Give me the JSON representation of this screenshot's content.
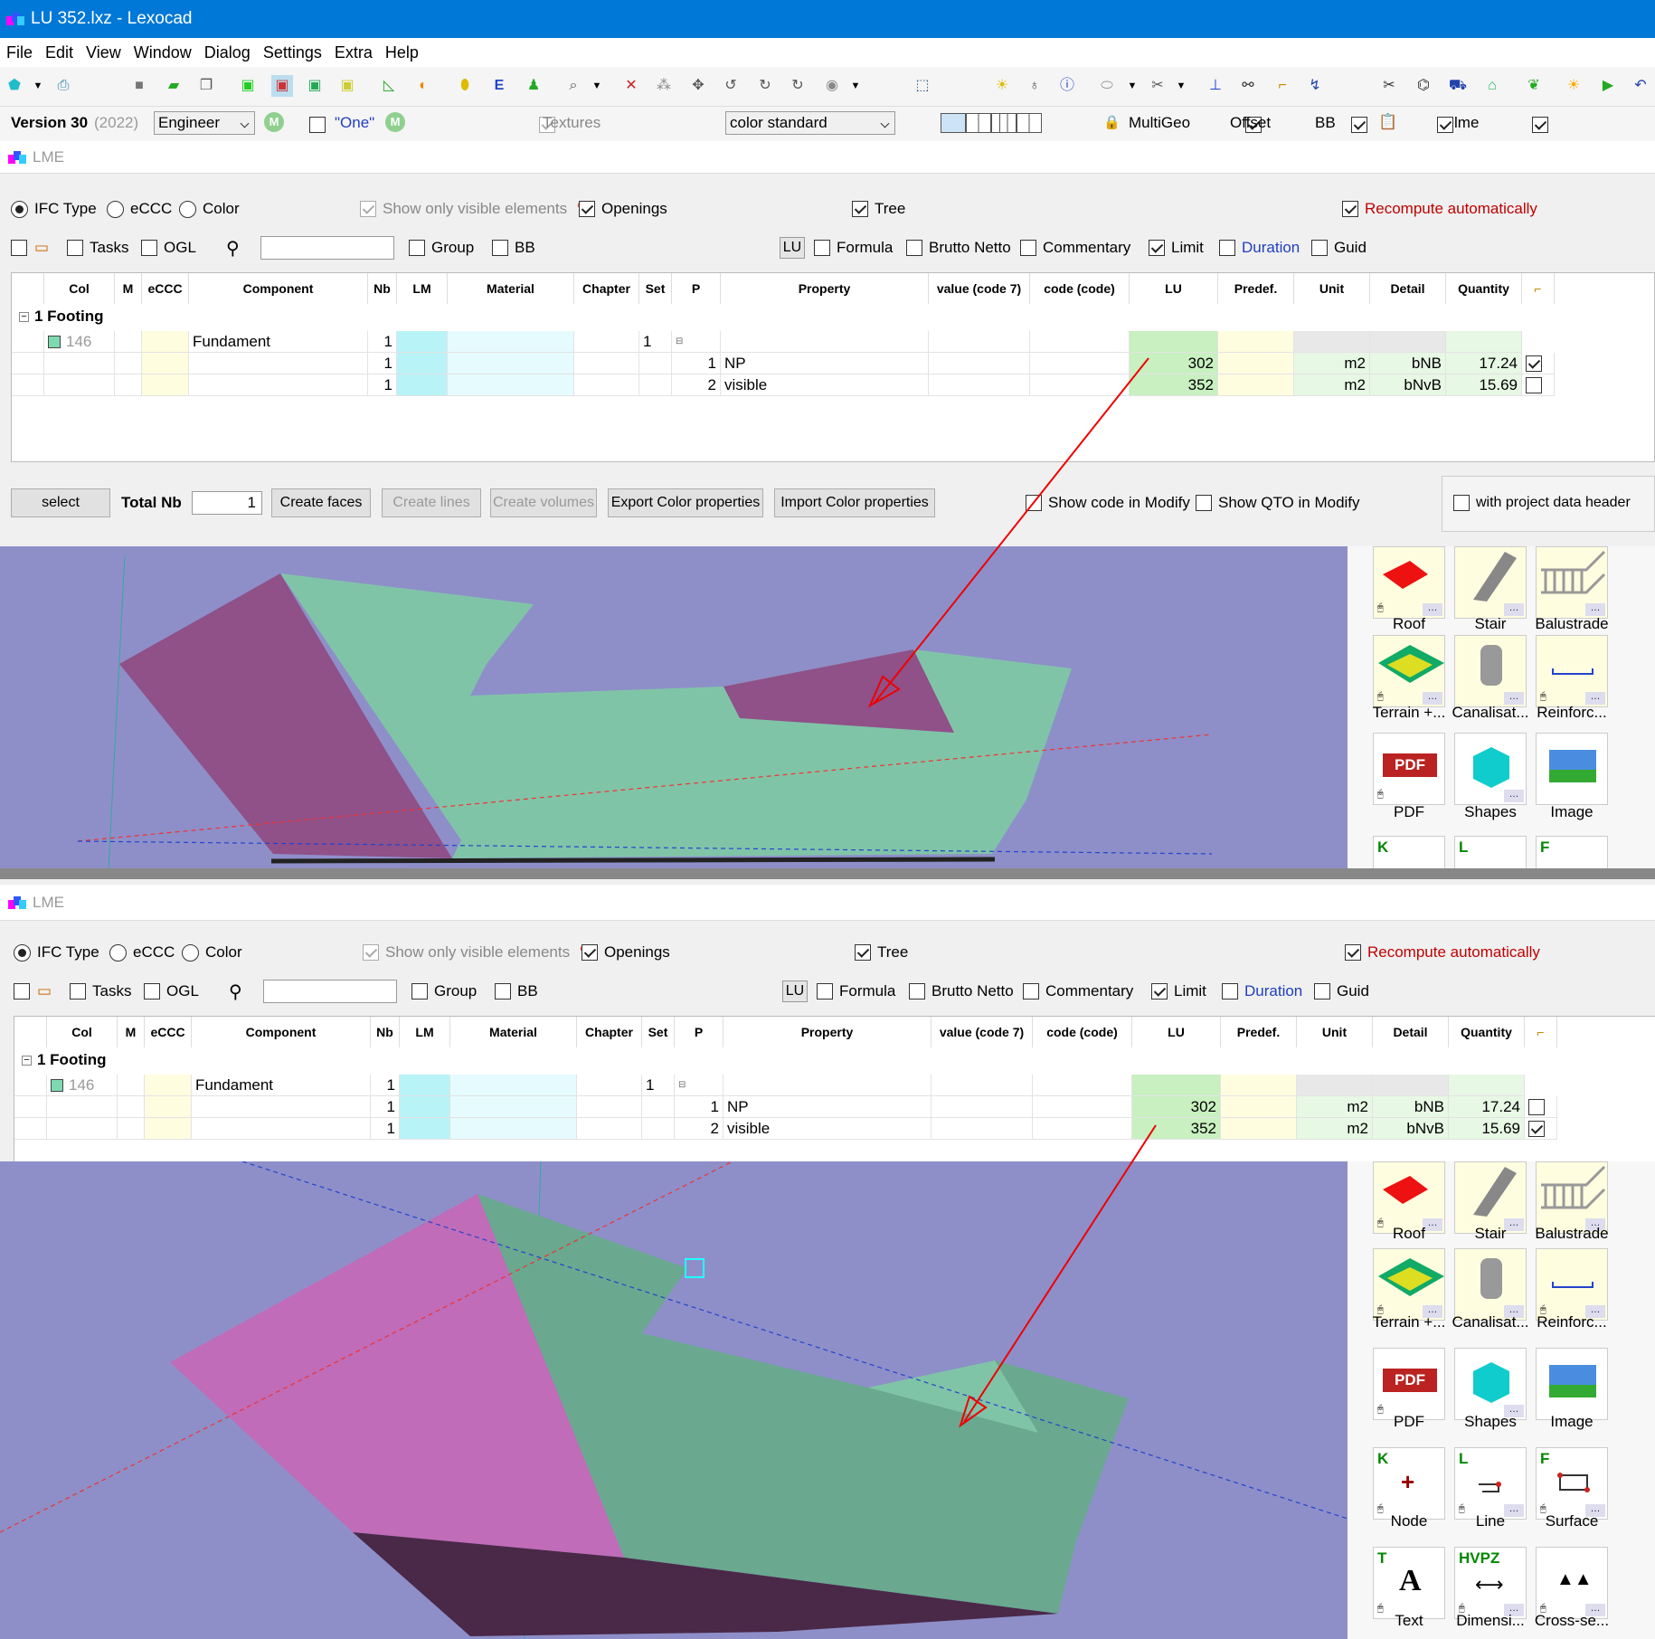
{
  "window": {
    "title": "LU 352.lxz - Lexocad"
  },
  "menu": [
    "File",
    "Edit",
    "View",
    "Window",
    "Dialog",
    "Settings",
    "Extra",
    "Help"
  ],
  "versionbar": {
    "version_label": "Version 30",
    "version_year": "(2022)",
    "role_select": "Engineer",
    "m_badge": "M",
    "one_label": "\"One\"",
    "textures_label": "Textures",
    "color_select": "color standard",
    "multigeo_label": "MultiGeo",
    "offset_label": "Offset",
    "bb_label": "BB",
    "lme_label": "lme"
  },
  "lme_panel": {
    "title": "LME",
    "radio_ifc": "IFC Type",
    "radio_ecc": "eCCC",
    "radio_color": "Color",
    "show_visible": "Show only visible elements",
    "openings": "Openings",
    "tree": "Tree",
    "recompute": "Recompute automatically",
    "tasks": "Tasks",
    "ogl": "OGL",
    "search_value": "",
    "group": "Group",
    "bb": "BB",
    "lu_btn": "LU",
    "formula": "Formula",
    "brutto_netto": "Brutto Netto",
    "commentary": "Commentary",
    "limit": "Limit",
    "duration": "Duration",
    "guid": "Guid"
  },
  "grid": {
    "headers": [
      "Col",
      "M",
      "eCCC",
      "Component",
      "Nb",
      "LM",
      "Material",
      "Chapter",
      "Set",
      "P",
      "Property",
      "value (code 7)",
      "code (code)",
      "LU",
      "Predef.",
      "Unit",
      "Detail",
      "Quantity"
    ],
    "group_label": "1 Footing",
    "component_row": {
      "col": "146",
      "component": "Fundament",
      "nb": "1",
      "set": "1"
    },
    "rows": [
      {
        "nb": "1",
        "p": "1",
        "property": "NP",
        "lu": "302",
        "unit": "m2",
        "detail": "bNB",
        "quantity": "17.24"
      },
      {
        "nb": "1",
        "p": "2",
        "property": "visible",
        "lu": "352",
        "unit": "m2",
        "detail": "bNvB",
        "quantity": "15.69"
      }
    ]
  },
  "bottombar": {
    "select": "select",
    "total_nb": "Total Nb",
    "total_value": "1",
    "create_faces": "Create faces",
    "create_lines": "Create lines",
    "create_volumes": "Create volumes",
    "export": "Export Color properties",
    "import": "Import Color properties",
    "show_code": "Show code in Modify",
    "show_qto": "Show QTO in Modify",
    "project_header": "with project data header"
  },
  "palette": {
    "row1": [
      "Roof",
      "Stair",
      "Balustrade"
    ],
    "row2": [
      "Terrain +...",
      "Canalisat...",
      "Reinforc..."
    ],
    "row3": [
      "PDF",
      "Shapes",
      "Image"
    ],
    "row4_letters": [
      "K",
      "L",
      "F"
    ],
    "row4": [
      "Node",
      "Line",
      "Surface"
    ],
    "row5_letters": [
      "T",
      "HVPZ",
      ""
    ],
    "row5": [
      "Text",
      "Dimensi...",
      "Cross-se..."
    ],
    "pdf_text": "PDF",
    "text_glyph": "A"
  },
  "colors": {
    "accent": "#0078d7",
    "recompute": "#c00000",
    "duration": "#1f3fbf",
    "lu_green": "#c8f0c0",
    "viewport": "#8e8fc9"
  }
}
